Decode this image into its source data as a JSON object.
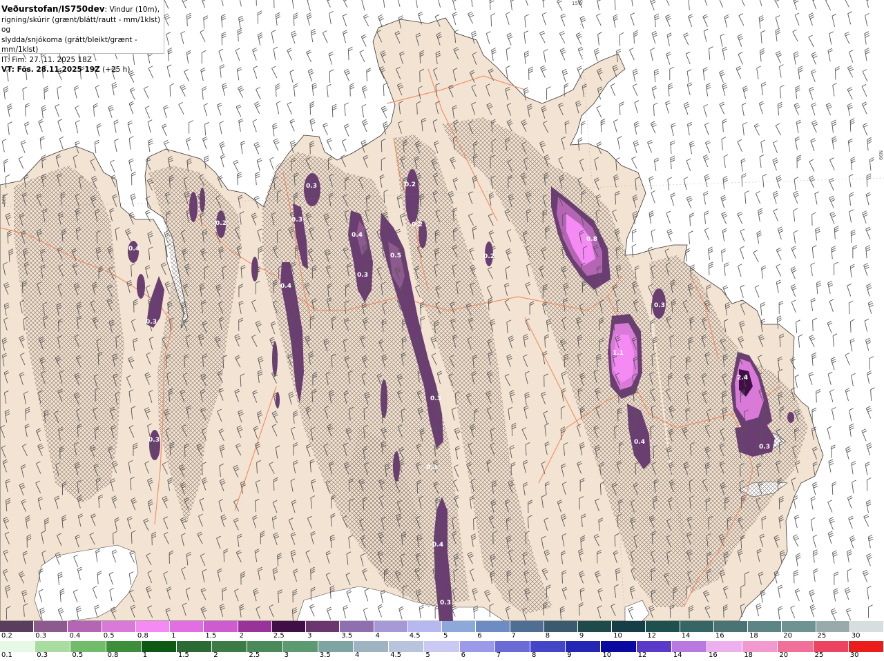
{
  "header": {
    "model": "Veðurstofan/IS750dev",
    "desc1": ": Vindur (10m),",
    "desc2": "rigning/skúrir (grænt/blátt/rautt - mm/1klst) og",
    "desc3": "slydda/snjókoma (grátt/bleikt/grænt - mm/1klst)",
    "it": "IT: Fim. 27. 11. 2025 18Z",
    "vt": "VT: Fös. 28.11.2025 19Z",
    "lead": "(+25 h)"
  },
  "coords": {
    "top": "15W",
    "left": "66N",
    "right": "66N"
  },
  "colors": {
    "land": "#f3e3d2",
    "sea": "#ffffff",
    "roads": "#f08a60"
  },
  "map_labels": [
    {
      "text": "0.3"
    },
    {
      "text": "0.4"
    },
    {
      "text": "0.3"
    },
    {
      "text": "0.5"
    },
    {
      "text": "0.3"
    },
    {
      "text": "0.2"
    },
    {
      "text": "0.4"
    },
    {
      "text": "0.2"
    },
    {
      "text": "0.8"
    },
    {
      "text": "0.3"
    },
    {
      "text": "1.1"
    },
    {
      "text": "0.4"
    },
    {
      "text": "2.4"
    },
    {
      "text": "0.3"
    },
    {
      "text": "0.4"
    },
    {
      "text": "0.3"
    },
    {
      "text": "0.4"
    },
    {
      "text": "0.3"
    },
    {
      "text": "0.3"
    },
    {
      "text": "0.3"
    },
    {
      "text": "0.2"
    },
    {
      "text": "0.3"
    },
    {
      "text": "0.2"
    }
  ],
  "legend_snow": {
    "labels": [
      "0.2",
      "0.3",
      "0.4",
      "0.5",
      "0.8",
      "1",
      "1.5",
      "2",
      "2.5",
      "3",
      "3.5",
      "4",
      "4.5",
      "5",
      "6",
      "7",
      "8",
      "9",
      "10",
      "12",
      "14",
      "16",
      "18",
      "20",
      "25",
      "30"
    ],
    "colors": [
      "#5a3e5e",
      "#8c5a8c",
      "#b466b4",
      "#d97ad9",
      "#f58af5",
      "#e36ee3",
      "#cf5ccf",
      "#99339a",
      "#3f0f45",
      "#6b356f",
      "#8e70b0",
      "#a59ad6",
      "#b8b8f0",
      "#8da9da",
      "#6e8cc4",
      "#4f6e93",
      "#3a5a70",
      "#1f4a4a",
      "#163e46",
      "#1f5050",
      "#356565",
      "#4a7474",
      "#5e8585",
      "#6f9292",
      "#98aaaa",
      "#d6dede"
    ]
  },
  "legend_rain": {
    "labels": [
      "0.1",
      "0.3",
      "0.5",
      "0.8",
      "1",
      "1.5",
      "2",
      "2.5",
      "3",
      "3.5",
      "4",
      "4.5",
      "5",
      "6",
      "7",
      "8",
      "9",
      "10",
      "12",
      "14",
      "16",
      "18",
      "20",
      "25",
      "30"
    ],
    "colors": [
      "#e6f8e6",
      "#a9dca0",
      "#72bb6a",
      "#3d8e3a",
      "#0e5a14",
      "#2b6a33",
      "#3c7a46",
      "#4a8a5a",
      "#5d9a72",
      "#7fa4a4",
      "#9fb4c0",
      "#b8c4dc",
      "#c9c9f4",
      "#9a9ae8",
      "#6b6bd8",
      "#4545c8",
      "#2626b4",
      "#0a0aa0",
      "#5a3ac8",
      "#b87ae0",
      "#ecb0ee",
      "#f29ad0",
      "#f0709a",
      "#ec4460",
      "#ea1c1c"
    ]
  }
}
